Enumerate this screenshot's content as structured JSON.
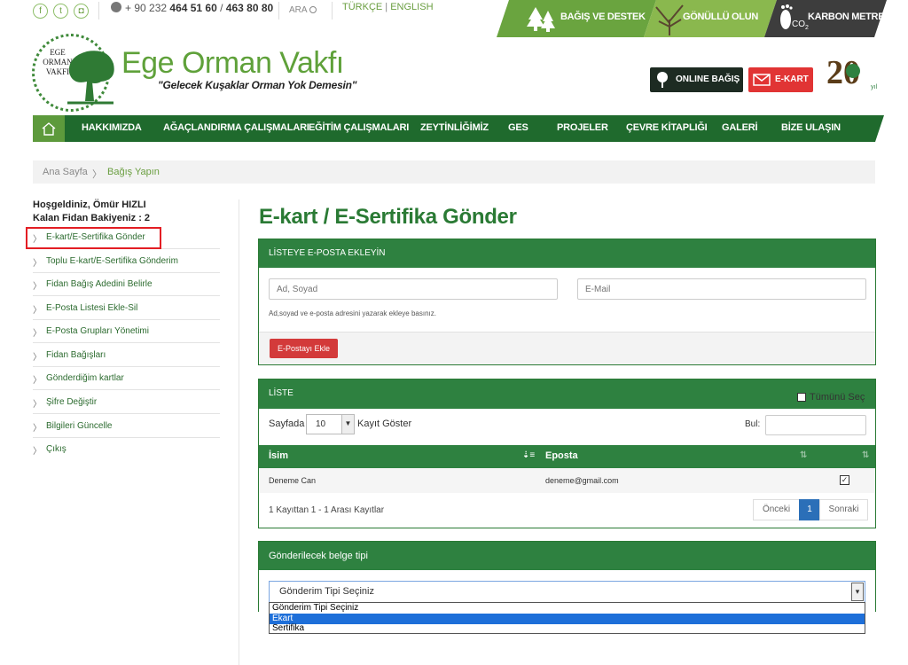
{
  "topbar": {
    "social": [
      {
        "name": "facebook-icon",
        "glyph": "f"
      },
      {
        "name": "twitter-icon",
        "glyph": "t"
      },
      {
        "name": "instagram-icon",
        "glyph": "◘"
      }
    ],
    "phone_prefix": "+ 90 232 ",
    "phone_1": "464 51 60",
    "phone_sep": " / ",
    "phone_2": "463 80 80",
    "search_label": "ARA",
    "lang_tr": "TÜRKÇE",
    "lang_sep": " | ",
    "lang_en": "ENGLISH",
    "quick_links": [
      {
        "label": "BAĞIŞ VE DESTEK",
        "color": "#6aa43f"
      },
      {
        "label": "GÖNÜLLÜ OLUN",
        "color": "#8ab84e"
      },
      {
        "label": "KARBON METRE",
        "color": "#3d3d3d"
      }
    ],
    "co2_label": "CO",
    "co2_sub": "2"
  },
  "logo": {
    "ring_line1": "EGE",
    "ring_line2": "ORMAN",
    "ring_line3": "VAKFI",
    "title": "Ege Orman Vakfı",
    "slogan": "\"Gelecek Kuşaklar Orman Yok Demesin\"",
    "badge_number": "20",
    "badge_suffix": "yıl"
  },
  "header_buttons": {
    "online": "ONLINE BAĞIŞ",
    "ekart": "E-KART"
  },
  "nav": {
    "items": [
      "HAKKIMIZDA",
      "AĞAÇLANDIRMA ÇALIŞMALARI",
      "EĞİTİM ÇALIŞMALARI",
      "ZEYTİNLİĞİMİZ",
      "GES",
      "PROJELER",
      "ÇEVRE KİTAPLIĞI",
      "GALERİ",
      "BİZE ULAŞIN"
    ]
  },
  "breadcrumb": {
    "home": "Ana Sayfa",
    "current": "Bağış Yapın"
  },
  "sidebar": {
    "welcome": "Hoşgeldiniz, Ömür HIZLI",
    "balance": "Kalan Fidan Bakiyeniz : 2",
    "items": [
      "E-kart/E-Sertifika Gönder",
      "Toplu E-kart/E-Sertifika Gönderim",
      "Fidan Bağış Adedini Belirle",
      "E-Posta Listesi Ekle-Sil",
      "E-Posta Grupları Yönetimi",
      "Fidan Bağışları",
      "Gönderdiğim kartlar",
      "Şifre Değiştir",
      "Bilgileri Güncelle",
      "Çıkış"
    ]
  },
  "main": {
    "title": "E-kart / E-Sertifika Gönder",
    "add_panel": {
      "heading": "LİSTEYE E-POSTA EKLEYİN",
      "name_placeholder": "Ad, Soyad",
      "email_placeholder": "E-Mail",
      "hint": "Ad,soyad ve e-posta adresini yazarak ekleye basınız.",
      "add_button": "E-Postayı Ekle"
    },
    "list_panel": {
      "heading": "LİSTE",
      "select_all": "Tümünü Seç",
      "page_size_prefix": "Sayfada",
      "page_size_value": "10",
      "page_size_suffix": "Kayıt Göster",
      "search_label": "Bul:",
      "columns": [
        "İsim",
        "Eposta"
      ],
      "rows": [
        {
          "name": "Deneme Can",
          "email": "deneme@gmail.com",
          "checked": true
        }
      ],
      "summary": "1 Kayıttan 1 - 1 Arası Kayıtlar",
      "prev": "Önceki",
      "page": "1",
      "next": "Sonraki"
    },
    "doc_panel": {
      "heading": "Gönderilecek belge tipi",
      "selected": "Gönderim Tipi Seçiniz",
      "options": [
        "Gönderim Tipi Seçiniz",
        "Ekart",
        "Sertifika"
      ],
      "highlighted_option": "Ekart"
    }
  },
  "colors": {
    "brand_green": "#2e8140",
    "light_green": "#5fa13a",
    "red": "#e13434",
    "highlight_red": "#e31e24"
  }
}
